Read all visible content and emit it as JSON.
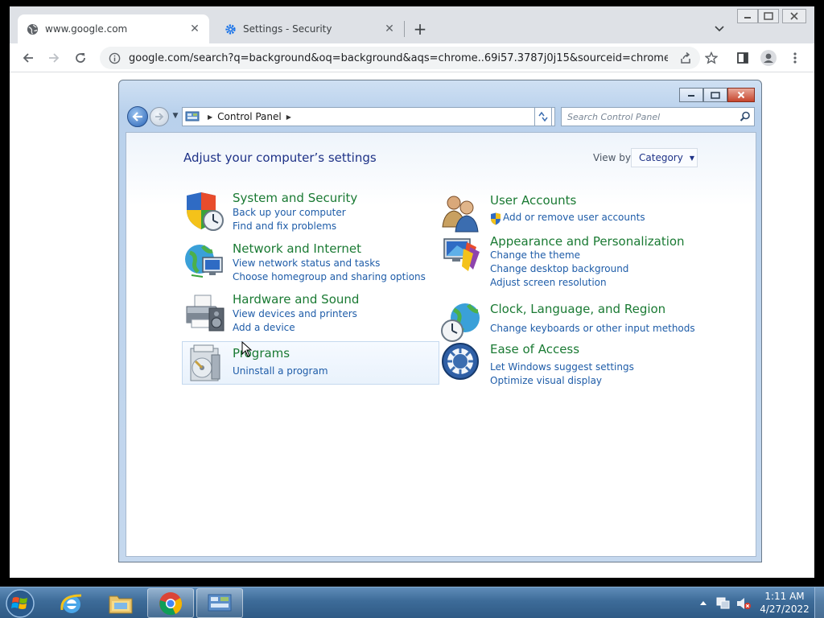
{
  "browser": {
    "tabs": [
      {
        "title": "www.google.com",
        "icon": "globe-icon",
        "active": true
      },
      {
        "title": "Settings - Security",
        "icon": "gear-icon",
        "active": false
      }
    ],
    "url": "google.com/search?q=background&oq=background&aqs=chrome..69i57.3787j0j15&sourceid=chrome&ie..."
  },
  "control_panel": {
    "breadcrumb": "Control Panel",
    "search_placeholder": "Search Control Panel",
    "heading": "Adjust your computer’s settings",
    "view_by_label": "View by:",
    "view_by_value": "Category",
    "categories": [
      {
        "title": "System and Security",
        "icon": "shield-icon",
        "links": [
          "Back up your computer",
          "Find and fix problems"
        ]
      },
      {
        "title": "Network and Internet",
        "icon": "network-icon",
        "links": [
          "View network status and tasks",
          "Choose homegroup and sharing options"
        ]
      },
      {
        "title": "Hardware and Sound",
        "icon": "printer-icon",
        "links": [
          "View devices and printers",
          "Add a device"
        ]
      },
      {
        "title": "Programs",
        "icon": "programs-icon",
        "links": [
          "Uninstall a program"
        ]
      },
      {
        "title": "User Accounts",
        "icon": "users-icon",
        "links": [
          "Add or remove user accounts"
        ]
      },
      {
        "title": "Appearance and Personalization",
        "icon": "appearance-icon",
        "links": [
          "Change the theme",
          "Change desktop background",
          "Adjust screen resolution"
        ]
      },
      {
        "title": "Clock, Language, and Region",
        "icon": "globe-clock-icon",
        "links": [
          "Change keyboards or other input methods"
        ]
      },
      {
        "title": "Ease of Access",
        "icon": "ease-of-access-icon",
        "links": [
          "Let Windows suggest settings",
          "Optimize visual display"
        ]
      }
    ]
  },
  "taskbar": {
    "time": "1:11 AM",
    "date": "4/27/2022"
  },
  "colors": {
    "link": "#1e5ca8",
    "category_title": "#1a7a33",
    "heading": "#1e3287"
  }
}
